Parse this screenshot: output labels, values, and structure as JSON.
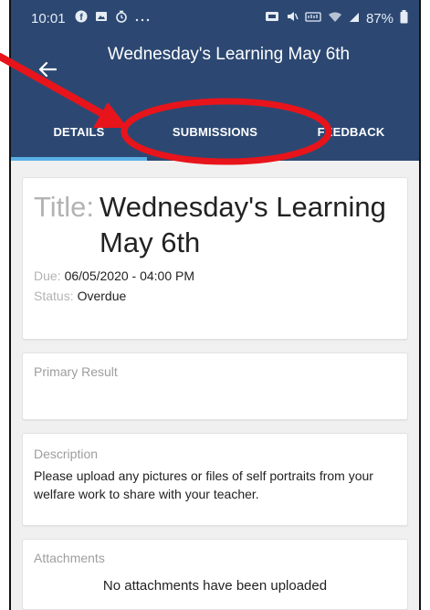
{
  "status_bar": {
    "time": "10:01",
    "battery": "87%",
    "icons": [
      "facebook-icon",
      "photo-icon",
      "alarm-icon",
      "more-icon",
      "wifi-icon",
      "signal-icon",
      "battery-icon"
    ]
  },
  "app_bar": {
    "title": "Wednesday's Learning May 6th",
    "back_icon": "arrow-left-icon"
  },
  "tabs": [
    {
      "label": "DETAILS",
      "active": true
    },
    {
      "label": "SUBMISSIONS",
      "active": false
    },
    {
      "label": "FEEDBACK",
      "active": false
    }
  ],
  "assignment": {
    "title_key": "Title:",
    "title": "Wednesday's Learning May 6th",
    "due_key": "Due:",
    "due": "06/05/2020 - 04:00 PM",
    "status_key": "Status:",
    "status": "Overdue"
  },
  "primary_result": {
    "label": "Primary Result"
  },
  "description": {
    "label": "Description",
    "text": "Please upload any pictures or files of self portraits from your welfare work to share with your teacher."
  },
  "attachments": {
    "label": "Attachments",
    "empty_text": "No attachments have been uploaded"
  },
  "colors": {
    "header": "#2c4872",
    "tab_indicator": "#5ab0e6",
    "annotation": "#e8141b"
  }
}
